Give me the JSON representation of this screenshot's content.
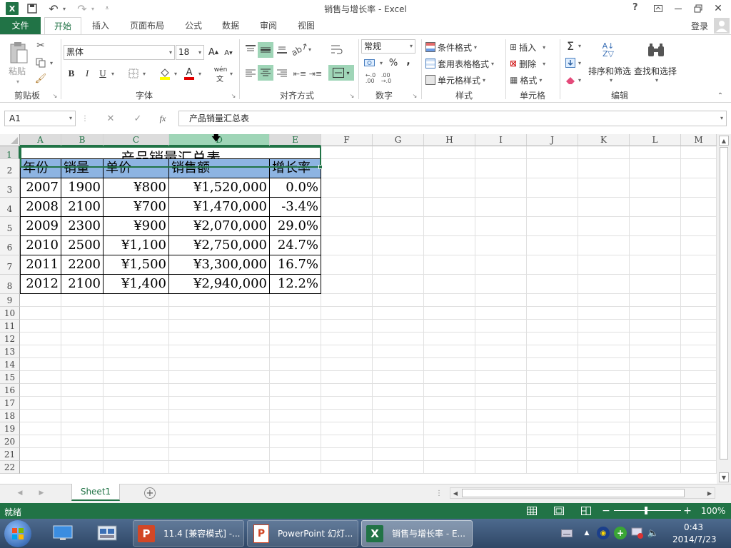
{
  "window": {
    "title": "销售与增长率 - Excel",
    "help_label": "?",
    "login_label": "登录"
  },
  "tabs": [
    "文件",
    "开始",
    "插入",
    "页面布局",
    "公式",
    "数据",
    "审阅",
    "视图"
  ],
  "active_tab": "开始",
  "ribbon": {
    "clipboard": {
      "paste_label": "粘贴",
      "group_label": "剪贴板"
    },
    "font": {
      "font_name": "黑体",
      "font_size": "18",
      "bold": "B",
      "italic": "I",
      "underline": "U",
      "phonetic": "wén",
      "group_label": "字体"
    },
    "alignment": {
      "group_label": "对齐方式"
    },
    "number": {
      "format": "常规",
      "percent": "%",
      "comma": ",",
      "group_label": "数字"
    },
    "styles": {
      "conditional": "条件格式",
      "table": "套用表格格式",
      "cell": "单元格样式",
      "group_label": "样式"
    },
    "cells": {
      "insert": "插入",
      "delete": "删除",
      "format": "格式",
      "group_label": "单元格"
    },
    "editing": {
      "sort_filter": "排序和筛选",
      "find_select": "查找和选择",
      "group_label": "编辑"
    }
  },
  "formula_bar": {
    "name_box": "A1",
    "cancel": "✕",
    "enter": "✓",
    "fx": "fx",
    "content": "产品销量汇总表"
  },
  "columns": [
    "A",
    "B",
    "C",
    "D",
    "E",
    "F",
    "G",
    "H",
    "I",
    "J",
    "K",
    "L",
    "M"
  ],
  "rows": [
    "1",
    "2",
    "3",
    "4",
    "5",
    "6",
    "7",
    "8",
    "9",
    "10",
    "11",
    "12",
    "13",
    "14",
    "15",
    "16",
    "17",
    "18",
    "19",
    "20",
    "21",
    "22"
  ],
  "sheet": {
    "title": "产品销量汇总表",
    "headers": [
      "年份",
      "销量",
      "单价",
      "销售额",
      "增长率"
    ],
    "data": [
      [
        "2007",
        "1900",
        "¥800",
        "¥1,520,000",
        "0.0%"
      ],
      [
        "2008",
        "2100",
        "¥700",
        "¥1,470,000",
        "-3.4%"
      ],
      [
        "2009",
        "2300",
        "¥900",
        "¥2,070,000",
        "29.0%"
      ],
      [
        "2010",
        "2500",
        "¥1,100",
        "¥2,750,000",
        "24.7%"
      ],
      [
        "2011",
        "2200",
        "¥1,500",
        "¥3,300,000",
        "16.7%"
      ],
      [
        "2012",
        "2100",
        "¥1,400",
        "¥2,940,000",
        "12.2%"
      ]
    ]
  },
  "sheet_tabs": [
    "Sheet1"
  ],
  "status": {
    "ready": "就绪",
    "zoom": "100%"
  },
  "taskbar": {
    "items": [
      "11.4 [兼容模式] -...",
      "PowerPoint 幻灯...",
      "销售与增长率 - E..."
    ],
    "time": "0:43",
    "date": "2014/7/23"
  },
  "colors": {
    "accent": "#217346",
    "header_fill": "#8db4e2",
    "selection": "#217346"
  }
}
